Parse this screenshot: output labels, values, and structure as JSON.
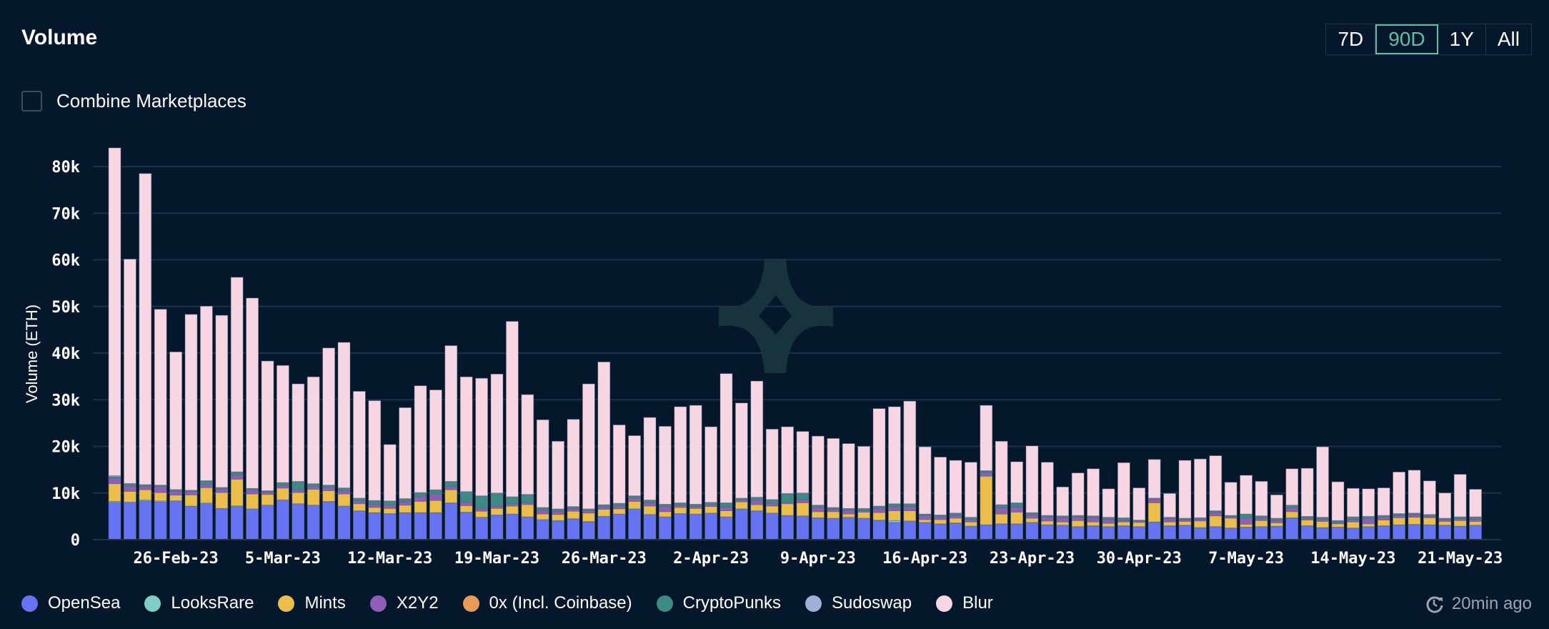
{
  "header": {
    "title": "Volume"
  },
  "range_buttons": [
    {
      "label": "7D",
      "active": false
    },
    {
      "label": "90D",
      "active": true
    },
    {
      "label": "1Y",
      "active": false
    },
    {
      "label": "All",
      "active": false
    }
  ],
  "combine_marketplaces": {
    "label": "Combine Marketplaces",
    "checked": false
  },
  "status": {
    "icon": "refresh-clock-icon",
    "text": "20min ago"
  },
  "watermark": {
    "icon": "four-point-star-logo-icon"
  },
  "chart_data": {
    "type": "bar",
    "stacked": true,
    "title": "Volume",
    "xlabel": "",
    "ylabel": "Volume (ETH)",
    "ylim": [
      0,
      80000
    ],
    "yticks": [
      0,
      10000,
      20000,
      30000,
      40000,
      50000,
      60000,
      70000,
      80000
    ],
    "ytick_labels": [
      "0",
      "10k",
      "20k",
      "30k",
      "40k",
      "50k",
      "60k",
      "70k",
      "80k"
    ],
    "grid": true,
    "legend_position": "bottom-left",
    "x_start": "22-Feb-23",
    "x_tick_labels": [
      {
        "index": 4,
        "label": "26-Feb-23"
      },
      {
        "index": 11,
        "label": "5-Mar-23"
      },
      {
        "index": 18,
        "label": "12-Mar-23"
      },
      {
        "index": 25,
        "label": "19-Mar-23"
      },
      {
        "index": 32,
        "label": "26-Mar-23"
      },
      {
        "index": 39,
        "label": "2-Apr-23"
      },
      {
        "index": 46,
        "label": "9-Apr-23"
      },
      {
        "index": 53,
        "label": "16-Apr-23"
      },
      {
        "index": 60,
        "label": "23-Apr-23"
      },
      {
        "index": 67,
        "label": "30-Apr-23"
      },
      {
        "index": 74,
        "label": "7-May-23"
      },
      {
        "index": 81,
        "label": "14-May-23"
      },
      {
        "index": 88,
        "label": "21-May-23"
      }
    ],
    "series": [
      {
        "name": "OpenSea",
        "color": "#6673f2",
        "values": [
          8000,
          7900,
          8300,
          8100,
          8200,
          7100,
          7700,
          6600,
          7100,
          6500,
          7300,
          8400,
          7600,
          7300,
          8100,
          7100,
          6100,
          5700,
          5500,
          5700,
          5700,
          5700,
          7800,
          5800,
          4700,
          5200,
          5400,
          4800,
          4200,
          4000,
          4400,
          3800,
          4900,
          5400,
          6500,
          5300,
          4800,
          5500,
          5400,
          5600,
          4800,
          6500,
          6100,
          5600,
          5100,
          5000,
          4600,
          4500,
          4700,
          4500,
          4100,
          3700,
          3900,
          3600,
          3300,
          3500,
          2800,
          3100,
          3300,
          3300,
          3600,
          3100,
          3000,
          2700,
          2900,
          2700,
          2900,
          2700,
          3700,
          2900,
          3000,
          2500,
          2700,
          2400,
          2600,
          2700,
          2800,
          4600,
          2900,
          2500,
          2600,
          2400,
          2700,
          2900,
          3100,
          3200,
          3100,
          3000,
          2800,
          3000
        ]
      },
      {
        "name": "LooksRare",
        "color": "#7fcec5",
        "values": [
          200,
          150,
          200,
          200,
          150,
          100,
          150,
          100,
          150,
          100,
          100,
          150,
          100,
          100,
          100,
          100,
          100,
          100,
          100,
          100,
          100,
          100,
          100,
          100,
          100,
          100,
          100,
          100,
          100,
          100,
          100,
          100,
          100,
          100,
          100,
          100,
          100,
          100,
          100,
          100,
          100,
          100,
          100,
          100,
          100,
          100,
          100,
          100,
          100,
          100,
          100,
          400,
          100,
          100,
          100,
          100,
          100,
          100,
          100,
          100,
          100,
          100,
          100,
          100,
          100,
          100,
          100,
          100,
          100,
          100,
          100,
          100,
          100,
          100,
          100,
          100,
          100,
          100,
          100,
          100,
          100,
          100,
          100,
          100,
          100,
          100,
          100,
          100,
          100,
          100
        ]
      },
      {
        "name": "Mints",
        "color": "#ebbd4b",
        "values": [
          3800,
          2300,
          2200,
          1800,
          1200,
          2400,
          3300,
          3400,
          5700,
          3200,
          2300,
          2500,
          2400,
          3400,
          2300,
          2600,
          1500,
          1100,
          1100,
          1600,
          2400,
          2600,
          2800,
          1400,
          1300,
          1400,
          1700,
          2600,
          1200,
          1300,
          1600,
          1800,
          1500,
          1100,
          1600,
          1800,
          1100,
          1300,
          1200,
          1400,
          1300,
          1500,
          1300,
          1500,
          2500,
          2800,
          1300,
          1400,
          700,
          1300,
          1600,
          2100,
          2200,
          600,
          900,
          1000,
          900,
          10400,
          2100,
          2500,
          900,
          800,
          700,
          1300,
          800,
          700,
          800,
          900,
          4100,
          800,
          800,
          1400,
          2300,
          2100,
          600,
          1300,
          700,
          1300,
          1200,
          1300,
          700,
          1300,
          600,
          1200,
          1500,
          1500,
          1500,
          800,
          1200,
          800
        ]
      },
      {
        "name": "X2Y2",
        "color": "#8f5fb8",
        "values": [
          1100,
          1100,
          700,
          1300,
          800,
          700,
          700,
          700,
          900,
          900,
          500,
          500,
          600,
          600,
          700,
          700,
          600,
          700,
          700,
          700,
          1000,
          1400,
          700,
          700,
          500,
          500,
          500,
          400,
          800,
          700,
          500,
          500,
          500,
          600,
          700,
          700,
          1100,
          500,
          400,
          400,
          800,
          400,
          900,
          600,
          300,
          600,
          900,
          500,
          800,
          300,
          800,
          800,
          900,
          800,
          600,
          600,
          500,
          800,
          1300,
          1100,
          700,
          800,
          900,
          700,
          900,
          800,
          300,
          300,
          800,
          700,
          300,
          400,
          700,
          300,
          1300,
          500,
          500,
          800,
          400,
          400,
          200,
          500,
          1100,
          600,
          500,
          500,
          300,
          400,
          400,
          500
        ]
      },
      {
        "name": "0x (Incl. Coinbase)",
        "color": "#e89a56",
        "values": [
          0,
          0,
          0,
          0,
          0,
          0,
          0,
          0,
          0,
          0,
          0,
          0,
          0,
          0,
          0,
          0,
          0,
          0,
          0,
          0,
          0,
          0,
          0,
          0,
          0,
          0,
          0,
          0,
          0,
          0,
          0,
          0,
          0,
          0,
          0,
          0,
          0,
          0,
          0,
          0,
          0,
          0,
          0,
          0,
          0,
          0,
          0,
          0,
          0,
          0,
          0,
          0,
          0,
          0,
          0,
          0,
          0,
          0,
          0,
          0,
          0,
          0,
          0,
          0,
          0,
          0,
          0,
          0,
          0,
          0,
          0,
          0,
          0,
          0,
          0,
          0,
          0,
          0,
          0,
          0,
          0,
          0,
          0,
          0,
          0,
          0,
          0,
          0,
          0,
          0
        ]
      },
      {
        "name": "CryptoPunks",
        "color": "#3d8a84",
        "values": [
          400,
          500,
          300,
          200,
          300,
          200,
          700,
          300,
          600,
          200,
          200,
          600,
          1700,
          500,
          400,
          500,
          500,
          700,
          800,
          600,
          800,
          800,
          1000,
          2200,
          2700,
          2700,
          1400,
          1700,
          500,
          400,
          400,
          300,
          400,
          500,
          400,
          500,
          400,
          400,
          400,
          400,
          800,
          300,
          600,
          700,
          1800,
          1400,
          400,
          300,
          300,
          400,
          500,
          600,
          500,
          300,
          300,
          400,
          400,
          300,
          600,
          800,
          400,
          300,
          300,
          300,
          300,
          400,
          500,
          100,
          100,
          200,
          300,
          200,
          300,
          200,
          800,
          400,
          400,
          500,
          300,
          400,
          400,
          500,
          400,
          300,
          300,
          300,
          300,
          200,
          300,
          400
        ]
      },
      {
        "name": "Sudoswap",
        "color": "#9fb0d6",
        "values": [
          200,
          100,
          100,
          100,
          100,
          100,
          100,
          100,
          100,
          100,
          100,
          100,
          100,
          100,
          100,
          100,
          100,
          100,
          100,
          100,
          100,
          100,
          100,
          100,
          100,
          100,
          100,
          100,
          100,
          100,
          100,
          100,
          100,
          100,
          100,
          100,
          100,
          100,
          100,
          100,
          100,
          100,
          100,
          100,
          100,
          100,
          100,
          100,
          100,
          100,
          100,
          100,
          100,
          100,
          100,
          100,
          100,
          100,
          100,
          100,
          100,
          100,
          100,
          100,
          100,
          100,
          100,
          100,
          100,
          100,
          100,
          100,
          100,
          100,
          100,
          100,
          100,
          100,
          100,
          100,
          100,
          100,
          100,
          100,
          100,
          100,
          100,
          100,
          100,
          100
        ]
      },
      {
        "name": "Blur",
        "color": "#f7d6e3",
        "values": [
          70300,
          48100,
          66700,
          37700,
          29500,
          37700,
          37400,
          36900,
          41700,
          40800,
          27800,
          25100,
          20900,
          22900,
          29400,
          31200,
          22900,
          21400,
          12100,
          19500,
          22900,
          21400,
          29100,
          24600,
          25200,
          25500,
          37600,
          21400,
          18800,
          14500,
          18700,
          26800,
          30600,
          16800,
          12900,
          17700,
          16700,
          20600,
          21200,
          16200,
          27700,
          20400,
          24900,
          15100,
          14300,
          13200,
          14800,
          14800,
          13900,
          13300,
          20900,
          20800,
          22000,
          14400,
          12400,
          11300,
          11800,
          14000,
          13600,
          8800,
          14300,
          11400,
          6200,
          9100,
          10100,
          6100,
          11800,
          6900,
          8300,
          5100,
          12400,
          12600,
          11800,
          7100,
          8300,
          7400,
          5000,
          7800,
          10300,
          15100,
          8300,
          6100,
          5900,
          5900,
          8900,
          9200,
          7200,
          5400,
          9100,
          5900
        ]
      }
    ]
  }
}
